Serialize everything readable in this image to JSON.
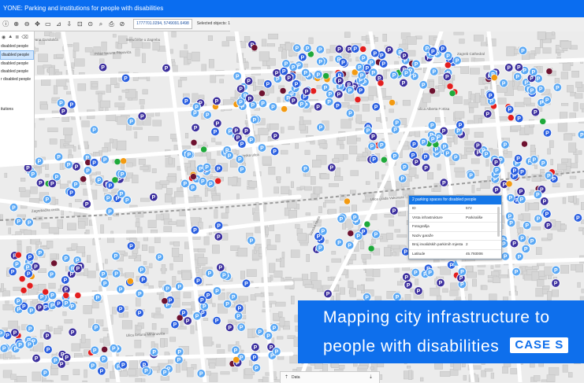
{
  "window": {
    "title": "YONE: Parking and institutions for people with disabilities"
  },
  "toolbar": {
    "coordinates": "1777701.0294, 5749091.6498",
    "selected_objects": "Selected objects: 1",
    "tools": [
      {
        "name": "info-tool-icon",
        "glyph": "ⓘ"
      },
      {
        "name": "zoom-in-icon",
        "glyph": "⊕"
      },
      {
        "name": "zoom-out-icon",
        "glyph": "⊖"
      },
      {
        "name": "pan-icon",
        "glyph": "✥"
      },
      {
        "name": "select-icon",
        "glyph": "▭"
      },
      {
        "name": "measure-icon",
        "glyph": "⊿"
      },
      {
        "name": "download-icon",
        "glyph": "⇩"
      },
      {
        "name": "zoom-extent-icon",
        "glyph": "⊡"
      },
      {
        "name": "target-icon",
        "glyph": "⊙"
      },
      {
        "name": "search-icon",
        "glyph": "⌕"
      },
      {
        "name": "print-icon",
        "glyph": "⎙"
      },
      {
        "name": "clear-icon",
        "glyph": "⊘"
      }
    ]
  },
  "sidebar": {
    "tools": [
      "◉",
      "▲",
      "≣",
      "⌫"
    ],
    "layers": [
      {
        "label": "disabled people",
        "selected": false
      },
      {
        "label": "disabled people",
        "selected": true
      },
      {
        "label": "disabled people",
        "selected": false
      },
      {
        "label": "disabled people",
        "selected": false
      },
      {
        "label": "r disabled people",
        "selected": false
      },
      {
        "label": "itutions",
        "selected": false
      }
    ]
  },
  "map": {
    "labels": [
      "Zagreb Cathedral",
      "Ulica Ivana Gundulića",
      "Sveučilište u Zagrebu",
      "Ulica Alberta Fortisa",
      "Prilaz baruna Filipovića",
      "Tratinska ulica",
      "Ulica grada Vukovara",
      "Savska cesta",
      "Zagrebačka cesta",
      "Ljubljanska avenija",
      "Ulica Antuna Mihanovića",
      "ZERICA"
    ],
    "colors": {
      "parking_light": "#5aa8f5",
      "parking_blue": "#2a5fe0",
      "parking_dark": "#3c2f9e",
      "institution_red": "#e31e1e",
      "institution_green": "#1ea93a",
      "institution_orange": "#f39a11",
      "institution_maroon": "#6e1230"
    },
    "marker_letter": "P"
  },
  "popup": {
    "title": "2 parking spaces for disabled people",
    "rows": [
      {
        "key": "ID",
        "value": "572"
      },
      {
        "key": "Vrsta infrastrukture",
        "value": "Parkirališe"
      },
      {
        "key": "Fotografija",
        "value": ""
      },
      {
        "key": "Naziv garaže",
        "value": ""
      },
      {
        "key": "Broj invalidskih parkirnih mjesta",
        "value": "2"
      },
      {
        "key": "Latitude",
        "value": "45.793006"
      }
    ]
  },
  "banner": {
    "line1": "Mapping city infrastructure to",
    "line2": "people with disabilities",
    "badge": "CASE S"
  },
  "bottom_bar": {
    "tab_label": "Data",
    "left_symbol": "⇡",
    "right_symbol": "⇣"
  }
}
